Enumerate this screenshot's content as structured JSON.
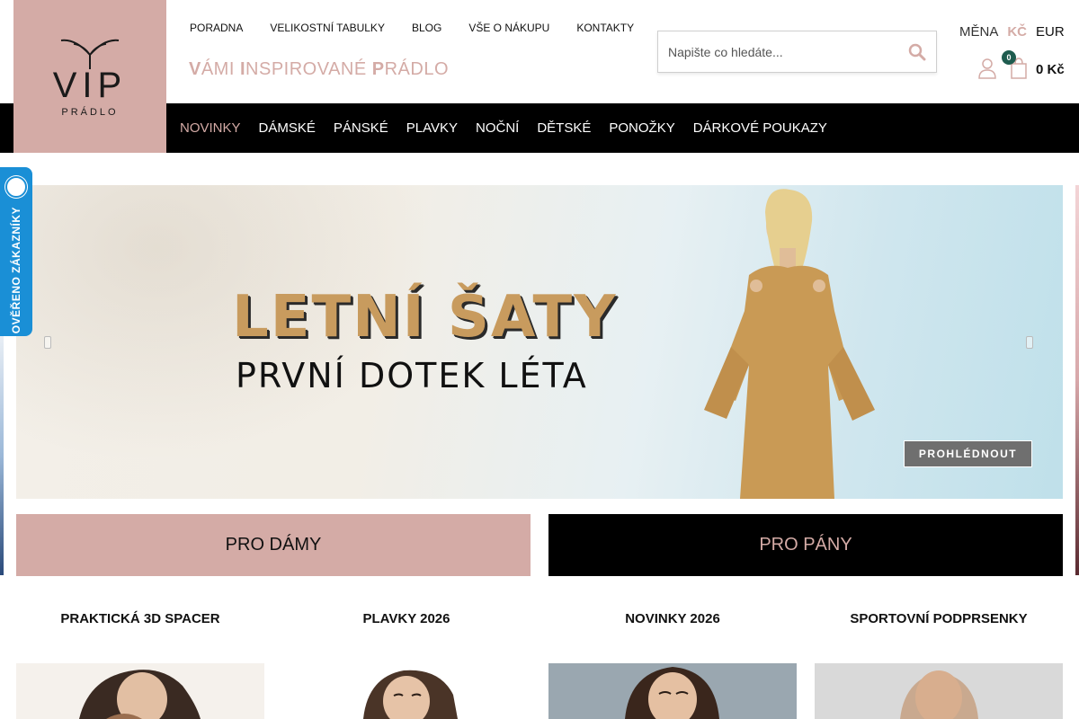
{
  "logo": {
    "text": "VIP",
    "subtext": "PRÁDLO"
  },
  "top_links": [
    "PORADNA",
    "VELIKOSTNÍ TABULKY",
    "BLOG",
    "VŠE O NÁKUPU",
    "KONTAKTY"
  ],
  "tagline": {
    "parts": [
      {
        "b": "V",
        "t": "ÁMI "
      },
      {
        "b": "I",
        "t": "NSPIROVANÉ "
      },
      {
        "b": "P",
        "t": "RÁDLO"
      }
    ]
  },
  "search": {
    "placeholder": "Napište co hledáte..."
  },
  "currency": {
    "label": "MĚNA",
    "active": "KČ",
    "other": "EUR"
  },
  "cart": {
    "count": "0",
    "total": "0 Kč"
  },
  "main_nav": [
    "NOVINKY",
    "DÁMSKÉ",
    "PÁNSKÉ",
    "PLAVKY",
    "NOČNÍ",
    "DĚTSKÉ",
    "PONOŽKY",
    "DÁRKOVÉ POUKAZY"
  ],
  "verified_badge": "OVĚŘENO ZÁKAZNÍKY",
  "hero": {
    "title": "LETNÍ ŠATY",
    "subtitle": "PRVNÍ DOTEK LÉTA",
    "button": "PROHLÉDNOUT"
  },
  "gender": {
    "women": "PRO DÁMY",
    "men": "PRO PÁNY"
  },
  "categories": [
    "PRAKTICKÁ 3D SPACER",
    "PLAVKY 2026",
    "NOVINKY 2026",
    "SPORTOVNÍ PODPRSENKY"
  ],
  "colors": {
    "accent": "#d4aba6",
    "nav_bg": "#000000",
    "badge_blue": "#1a8fd6",
    "cart_badge": "#1f5c4f"
  }
}
